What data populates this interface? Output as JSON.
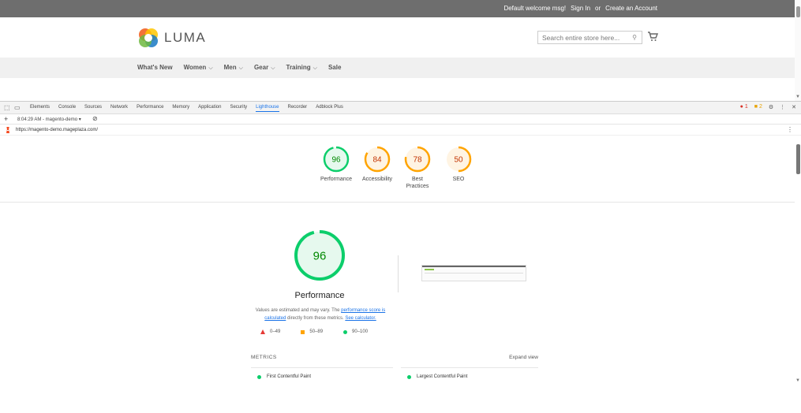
{
  "store": {
    "welcome": "Default welcome msg!",
    "sign_in": "Sign In",
    "or": "or",
    "create_account": "Create an Account",
    "logo_text": "LUMA",
    "search_placeholder": "Search entire store here...",
    "nav": [
      {
        "label": "What's New",
        "chevron": false
      },
      {
        "label": "Women",
        "chevron": true
      },
      {
        "label": "Men",
        "chevron": true
      },
      {
        "label": "Gear",
        "chevron": true
      },
      {
        "label": "Training",
        "chevron": true
      },
      {
        "label": "Sale",
        "chevron": false
      }
    ]
  },
  "devtools": {
    "tabs": [
      "Elements",
      "Console",
      "Sources",
      "Network",
      "Performance",
      "Memory",
      "Application",
      "Security",
      "Lighthouse",
      "Recorder",
      "Adblock Plus"
    ],
    "active_tab": "Lighthouse",
    "error_count": "1",
    "warning_count": "2",
    "report_select": "8:04:29 AM - magento-demo",
    "url": "https://magento-demo.mageplaza.com/"
  },
  "scores": [
    {
      "value": 96,
      "label": "Performance",
      "color": "#0cce6b",
      "text_color": "#008800",
      "bg": "#e6f9ee"
    },
    {
      "value": 84,
      "label": "Accessibility",
      "color": "#ffa400",
      "text_color": "#c33300",
      "bg": "#fff4e3"
    },
    {
      "value": 78,
      "label": "Best Practices",
      "color": "#ffa400",
      "text_color": "#c33300",
      "bg": "#fff4e3"
    },
    {
      "value": 50,
      "label": "SEO",
      "color": "#ffa400",
      "text_color": "#c33300",
      "bg": "#fff4e3"
    }
  ],
  "performance": {
    "score": 96,
    "title": "Performance",
    "note_prefix": "Values are estimated and may vary. The ",
    "note_link1": "performance score is calculated",
    "note_mid": " directly from these metrics. ",
    "note_link2": "See calculator.",
    "legend_fail": "0–49",
    "legend_average": "50–89",
    "legend_pass": "90–100",
    "metrics_label": "METRICS",
    "expand_label": "Expand view",
    "metrics": [
      "First Contentful Paint",
      "Largest Contentful Paint"
    ]
  }
}
